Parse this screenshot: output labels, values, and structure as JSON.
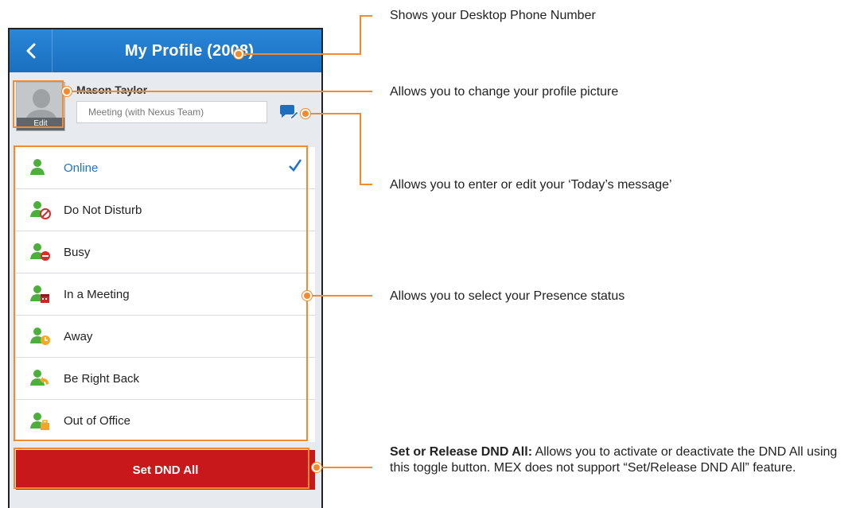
{
  "header": {
    "back_icon": "chevron-left-icon",
    "title": "My Profile (2008)"
  },
  "profile": {
    "avatar_edit_label": "Edit",
    "name": "Mason Taylor",
    "todays_message": "Meeting (with Nexus Team)",
    "message_icon": "chat-edit-icon"
  },
  "statuses": [
    {
      "label": "Online",
      "icon": "online-icon",
      "selected": true
    },
    {
      "label": "Do Not Disturb",
      "icon": "do-not-disturb-icon",
      "selected": false
    },
    {
      "label": "Busy",
      "icon": "busy-icon",
      "selected": false
    },
    {
      "label": "In a Meeting",
      "icon": "in-a-meeting-icon",
      "selected": false
    },
    {
      "label": "Away",
      "icon": "away-icon",
      "selected": false
    },
    {
      "label": "Be Right Back",
      "icon": "be-right-back-icon",
      "selected": false
    },
    {
      "label": "Out of Office",
      "icon": "out-of-office-icon",
      "selected": false
    }
  ],
  "dnd_button": "Set DND All",
  "annotations": {
    "phone_number": "Shows your Desktop Phone Number",
    "profile_picture": "Allows you to change your profile picture",
    "todays_message": "Allows you to enter or edit your ‘Today’s message’",
    "presence": "Allows you to select your Presence status",
    "dnd_heading": "Set or Release DND All:",
    "dnd_body": " Allows you to activate or deactivate the DND All using this toggle button. MEX does not support “Set/Release DND All” feature."
  },
  "colors": {
    "header_blue": "#1a6fbf",
    "selected_blue": "#1e73c8",
    "highlight_orange": "#f28a30",
    "dnd_red": "#c8181b",
    "presence_green": "#4caf3c"
  }
}
